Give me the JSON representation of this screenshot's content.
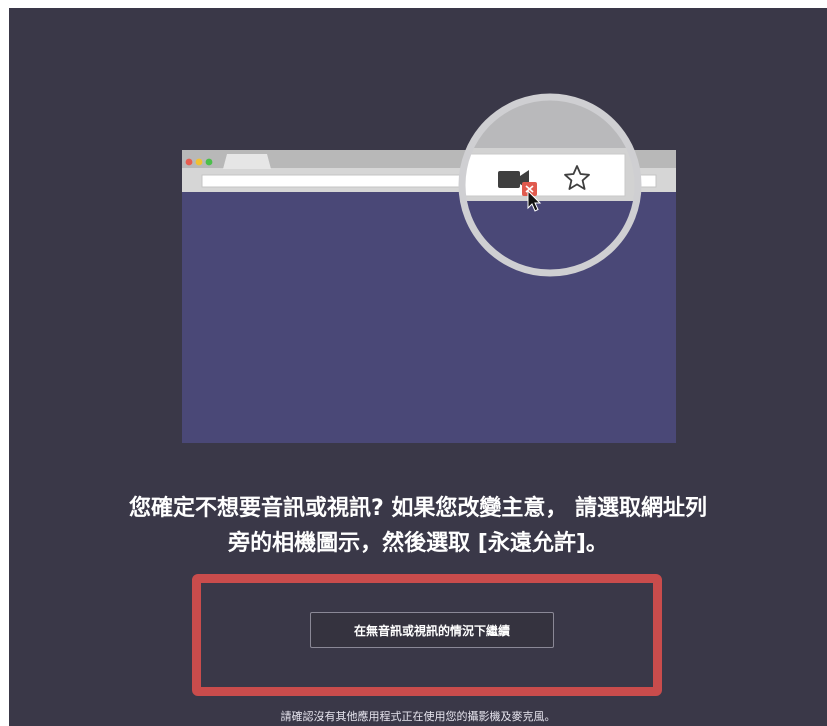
{
  "dialog": {
    "headline_line1": "您確定不想要音訊或視訊? 如果您改變主意， 請選取網址列",
    "headline_line2": "旁的相機圖示，然後選取 [永遠允許]。",
    "continue_button_label": "在無音訊或視訊的情況下繼續",
    "footnote": "請確認沒有其他應用程式正在使用您的攝影機及麥克風。"
  },
  "illustration": {
    "browser_dots": [
      "red",
      "yellow",
      "green"
    ],
    "address_bar_icons": [
      "camera-blocked-icon",
      "star-icon",
      "mouse-cursor-icon"
    ]
  },
  "colors": {
    "background": "#3a3848",
    "browser_content": "#4a4877",
    "highlight_border": "#c94c4c",
    "blocked_badge": "#e05a4e"
  }
}
